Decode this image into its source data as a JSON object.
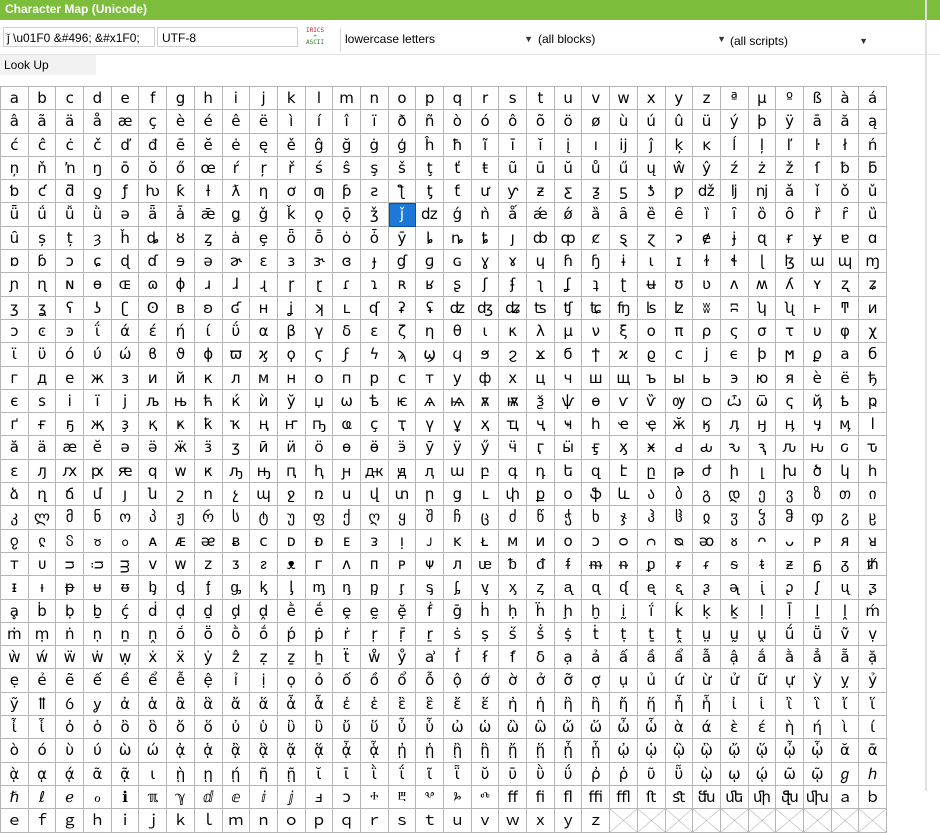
{
  "window": {
    "title": "Character Map (Unicode)"
  },
  "toolbar": {
    "code_value": "ǰ \\u01F0  &#496;  &#x1F0;",
    "encoding_value": "UTF-8",
    "ascii_icon": {
      "top": "IRICS",
      "plus": "+",
      "bottom": "ASCII"
    },
    "category_select": "lowercase letters",
    "block_select": "(all blocks)",
    "script_select": "(all scripts)"
  },
  "lookup": {
    "label": "Look Up"
  },
  "accent_color": "#7cbd3c",
  "selection_color": "#1e78d7",
  "grid": {
    "columns": 32,
    "selected_char": "ǰ",
    "rows": [
      "abcdefghijklmnopqrstuvwxyzªµºßàá",
      "âãäåæçèéêëìíîïðñòóôõöøùúûüýþÿāăą",
      "ćĉċčďđēĕėęěĝğġģĥħĩīĭįıĳĵķĸĺļľŀłń",
      "ņňŉŋōŏőœŕŗřśŝşšţťŧũūŭůűųŵŷźżžſƀƃ",
      "ƅƈƌƍƒƕƙƚƛƞơƣƥƨƪƫƭưƴƶƹƺƽƾƿǆǉǌǎǐǒǔ",
      "ǖǘǚǜǝǟǡǣǥǧǩǫǭǯǰǳǵǹǻǽǿȁȃȅȇȉȋȍȏȑȓȕ",
      "ȗșțȝȟȡȣȥȧȩȫȭȯȱȳȴȵȶȷȸȹȼȿɀɂɇɉɋɍɏɐɑ",
      "ɒɓɔɕɖɗɘəɚɛɜɝɞɟɠɡɢɣɤɥɦɧɨɩɪɫɬɭɮɯɰɱ",
      "ɲɳɴɵɶɷɸɹɺɻɼɽɾɿʀʁʂʃʄʅʆʇʈʉʊʋʌʍʎʏʐʑ",
      "ʒʓʕʖʗʘʙʚʛʜʝʞʟʠʡʢʣʤʥʦʧʨʩʪʫʬʭʮʯͱͳͷ",
      "ͻͼͽΐάέήίΰαβγδεζηθικλμνξοπρςστυφχψω",
      "ϊϋόύώϐϑϕϖϗϙϛϝϟϡϣϥϧϩϫϭϯϰϱϲϳϵϸϻϼабв",
      "гдежзийклмнопрстуфхцчшщъыьэюяѐёђѓ",
      "єѕіїјљњћќѝўџѡѣѥѧѩѫѭѯѱѳѵѷѹѻѽѿҁҋҍҏ",
      "ґғҕҗҙқҝҟҡңҥҧҩҫҭүұҳҵҷҹһҽҿӂӄӆӈӊӌӎӏ",
      "ӑӓӕӗәӛӝӟӡӣӥӧөӫӭӯӱӳӵӷӹӻӽӿԁԃԅԇԉԋԍԏ",
      "ԑԓԕԗԙԛԝԟԡԣԥԧԩԫԭԯաբգդեզէըթժիլխծկհ",
      "ձղճմյնշոչպջռսվտրցւփքօֆևაბგდევზთი",
      "კლმნოპჟრსტუფქღყშჩცძწჭხჯჰჱჲჳჴჵჶჷჸ",
      "ჹჺჽჾჿᴀᴁᴂᴃᴄᴅᴆᴇᴈᴉᴊᴋᴌᴍᴎᴏᴐᴑᴒᴓᴔᴕᴖᴗᴘᴙᴚ",
      "ᴛᴜᴝᴞᴟᴠᴡᴢᴣᴤᴥᴦᴧᴨᴩᴪᴫᵫᵬᵭᵮᵯᵰᵱᵲᵳᵴᵵᵶᵷᵹᵺ",
      "ᵻᵼᵽᵾᵿᶀᶁᶂᶃᶄᶅᶆᶇᶈᶉᶊᶋᶌᶍᶎᶏᶐᶑᶒᶓᶔᶕᶖᶗᶘᶙᶚ",
      "ḁḃḅḇḉḋḍḏḑḓḕḗḙḛḝḟḡḣḥḧḩḫḭḯḱḳḵḷḹḻḽḿ",
      "ṁṃṅṇṉṋṍṏṑṓṕṗṙṛṝṟṡṣṥṧṩṫṭṯṱṳṵṷṹṻṽṿ",
      "ẁẃẅẇẉẋẍẏẑẓẕẖẗẘẙẚẛẜẝẟạảấầẩẫậắằẳẵặ",
      "ẹẻẽếềểễệỉịọỏốồổỗộớờởỡợụủứừửữựỳỵỷ",
      "ỹỻỽỿἀἁἂἃἄἅἆἇἐἑἒἓἔἕἠἡἢἣἤἥἦἧἰἱἲἳἴἵ",
      "ἶἷὀὁὂὃὄὅὐὑὒὓὔὕὖὗὠὡὢὣὤὥὦὧὰάὲέὴήὶί",
      "ὸόὺύὼώᾀᾁᾂᾃᾄᾅᾆᾇᾐᾑᾒᾓᾔᾕᾖᾗᾠᾡᾢᾣᾤᾥᾦᾧᾰᾱ",
      "ᾲᾳᾴᾶᾷιῂῃῄῆῇῐῑῒΐῖῗῠῡῢΰῤῥῦῧῲῳῴῶῷℊℎ",
      "ℏℓℯℴℹℼℽⅆⅇⅈⅉⅎↄⰰⰱⰲⰳⰴﬀﬁﬂﬃﬄﬅﬆﬓﬔﬕﬖﬗａｂｃｄ",
      "ｅｆｇｈｉｊｋｌｍｎｏｐｑｒｓｔｕｖｗｘｙｚ"
    ]
  }
}
